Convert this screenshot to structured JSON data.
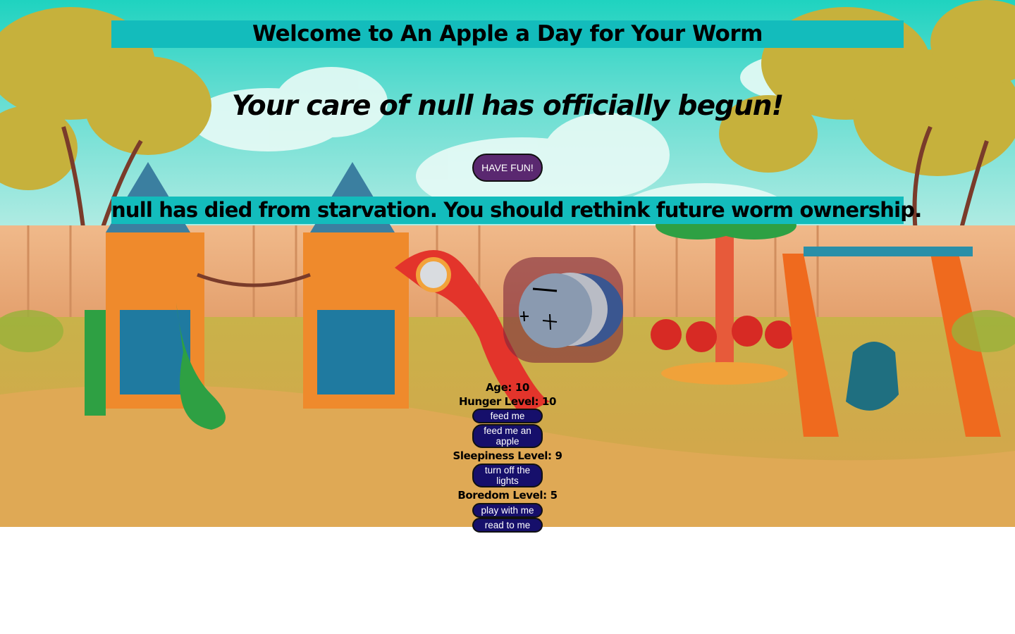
{
  "header": {
    "title": "Welcome to An Apple a Day for Your Worm"
  },
  "main": {
    "care_heading": "Your care of null has officially begun!",
    "have_fun_label": "HAVE FUN!",
    "status_message": "null has died from starvation. You should rethink future worm ownership."
  },
  "stats": {
    "age": "Age: 10",
    "hunger": "Hunger Level: 10",
    "sleepiness": "Sleepiness Level: 9",
    "boredom": "Boredom Level: 5"
  },
  "actions": {
    "feed": "feed me",
    "feed_apple": "feed me an apple",
    "lights": "turn off the lights",
    "play": "play with me",
    "read": "read to me"
  },
  "colors": {
    "banner": "#13bcbc",
    "have_fun_button": "#5a2870",
    "action_button": "#160f6b",
    "worm_backdrop": "#80283c",
    "worm_head": "#8a9ab0",
    "worm_mid": "#b9bcc5",
    "worm_tail": "#3a5690"
  },
  "icons": {
    "worm": "worm-icon",
    "background": "playground-illustration"
  }
}
